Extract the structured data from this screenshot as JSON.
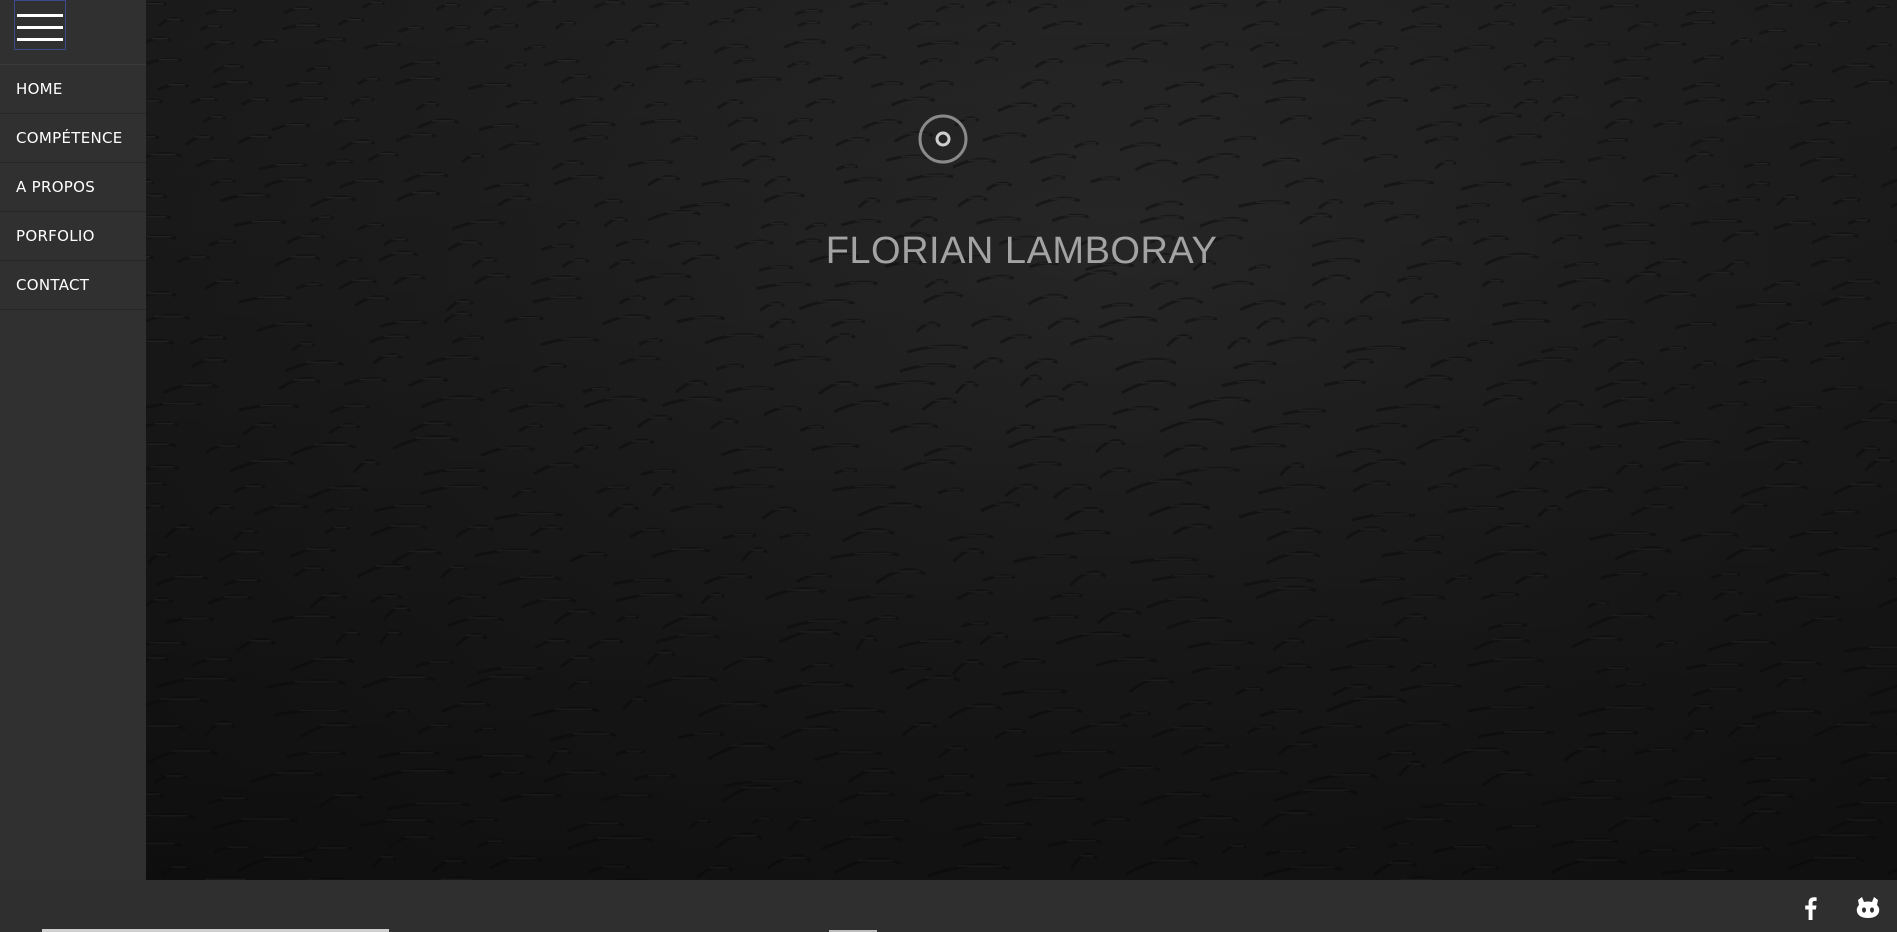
{
  "sidebar": {
    "menu_icon": "hamburger-icon",
    "items": [
      {
        "label": "HOME"
      },
      {
        "label": "COMPÉTENCE"
      },
      {
        "label": "A PROPOS"
      },
      {
        "label": "PORFOLIO"
      },
      {
        "label": "CONTACT"
      }
    ]
  },
  "hero": {
    "title": "FLORIAN LAMBORAY",
    "loader_icon": "spinner-icon"
  },
  "footer": {
    "social": [
      {
        "icon": "facebook-icon"
      },
      {
        "icon": "github-icon"
      }
    ]
  },
  "colors": {
    "sidebar_bg": "#303030",
    "title": "#a3a3a3",
    "nav_text": "#ffffff"
  }
}
